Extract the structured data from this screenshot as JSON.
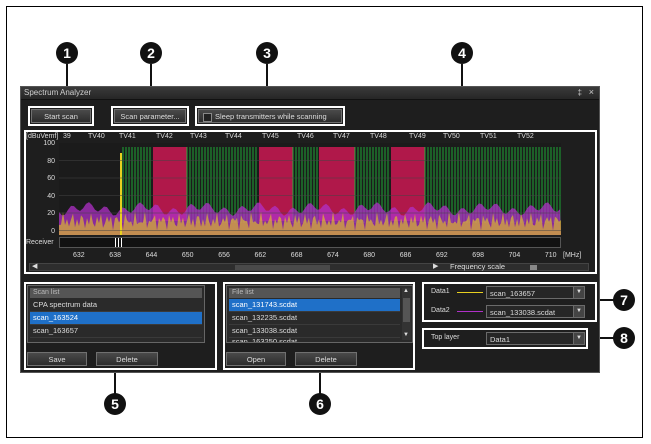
{
  "callouts": [
    "1",
    "2",
    "3",
    "4",
    "5",
    "6",
    "7",
    "8"
  ],
  "window": {
    "title": "Spectrum Analyzer",
    "pin": "‡",
    "close": "×"
  },
  "toolbar": {
    "start_scan": "Start scan",
    "scan_parameter": "Scan parameter...",
    "sleep_transmitters": "Sleep transmitters while scanning"
  },
  "spectrum": {
    "y_unit": "[dBuVemf]",
    "y_ticks": [
      "100",
      "80",
      "60",
      "40",
      "20",
      "0"
    ],
    "channels": [
      "39",
      "TV40",
      "TV41",
      "TV42",
      "TV43",
      "TV44",
      "TV45",
      "TV46",
      "TV47",
      "TV48",
      "TV49",
      "TV50",
      "TV51",
      "TV52"
    ],
    "receiver_label": "Receiver",
    "freq_ticks": [
      "632",
      "638",
      "644",
      "650",
      "656",
      "662",
      "668",
      "674",
      "680",
      "686",
      "692",
      "698",
      "704",
      "710"
    ],
    "freq_unit": "[MHz]",
    "scale_label": "Frequency scale",
    "colors": {
      "background": "#1b1b1b",
      "busy_channel": "#b0184a",
      "green_lines": "#1fbf3a",
      "magenta": "#b030c8",
      "yellow": "#e8d020"
    }
  },
  "scan_list": {
    "header": "Scan list",
    "items": [
      "CPA spectrum data",
      "scan_163524",
      "scan_163657"
    ],
    "selected_index": 1,
    "save": "Save",
    "delete": "Delete"
  },
  "file_list": {
    "header": "File list",
    "items": [
      "scan_131743.scdat",
      "scan_132235.scdat",
      "scan_133038.scdat",
      "scan_163250.scdat"
    ],
    "selected_index": 0,
    "open": "Open",
    "delete": "Delete"
  },
  "data_select": {
    "data1_label": "Data1",
    "data1_value": "scan_163657",
    "data1_color": "#e8d020",
    "data2_label": "Data2",
    "data2_value": "scan_133038.scdat",
    "data2_color": "#b030c8"
  },
  "top_layer": {
    "label": "Top layer",
    "value": "Data1"
  }
}
